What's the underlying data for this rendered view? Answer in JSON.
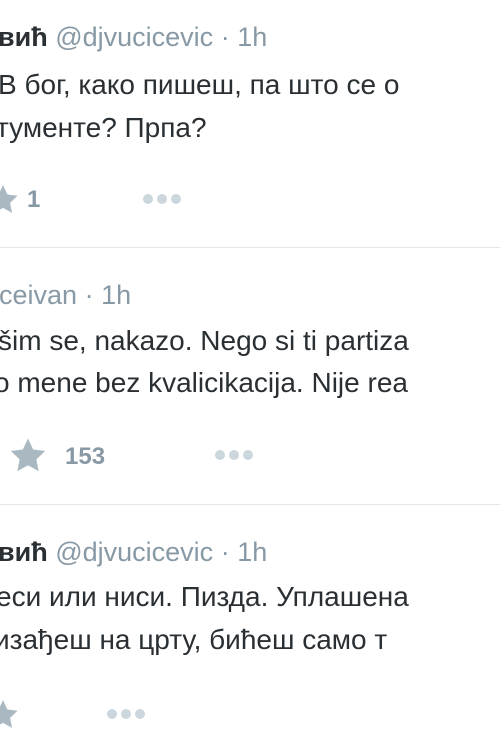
{
  "tweets": [
    {
      "name": "виħ",
      "handle": "@djvucicevic",
      "sep": "·",
      "time": "1h",
      "lines": [
        "В бог, како пишеш, па што се о",
        "тументе? Прпа?"
      ],
      "likes": "1",
      "like_icon": "star-icon",
      "more_icon": "more-dots-icon"
    },
    {
      "name": "",
      "handle": "ceivan",
      "sep": "·",
      "time": "1h",
      "lines": [
        "šim se, nakazo. Nego si ti partiza",
        "o mene bez kvalicikacija. Nije rea"
      ],
      "likes": "153",
      "like_icon": "star-icon",
      "more_icon": "more-dots-icon"
    },
    {
      "name": "виħ",
      "handle": "@djvucicevic",
      "sep": "·",
      "time": "1h",
      "lines": [
        "еси или ниси. Пизда. Уплашена",
        "изађеш на црту, бићеш само т"
      ],
      "likes": "",
      "like_icon": "star-icon",
      "more_icon": "more-dots-icon"
    }
  ],
  "colors": {
    "text": "#292f33",
    "muted": "#8899a6",
    "icon": "#aab8c2",
    "divider": "#e1e8ed"
  }
}
